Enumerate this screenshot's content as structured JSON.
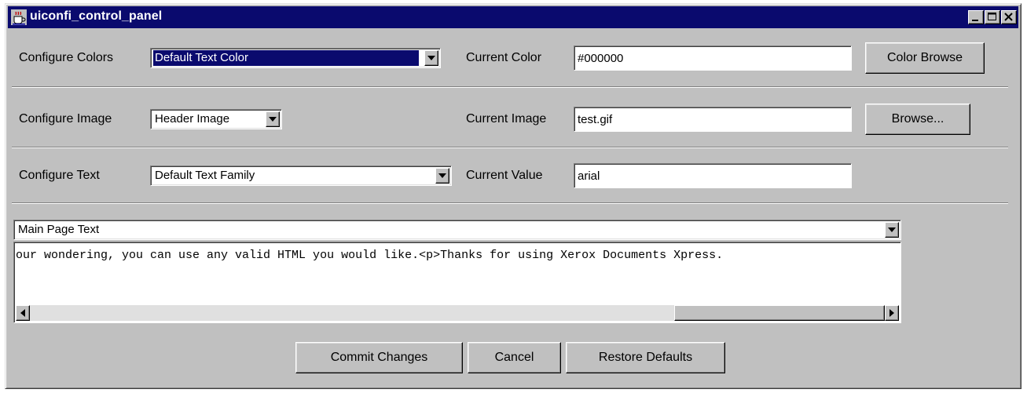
{
  "window": {
    "title": "uiconfi_control_panel",
    "icon": "java-coffee-icon",
    "controls": [
      "minimize-icon",
      "maximize-icon",
      "close-icon"
    ]
  },
  "colors": {
    "label": "Configure Colors",
    "selected": "Default Text Color",
    "current_label": "Current Color",
    "current_value": "#000000",
    "browse_label": "Color Browse"
  },
  "image": {
    "label": "Configure Image",
    "selected": "Header Image",
    "current_label": "Current Image",
    "current_value": "test.gif",
    "browse_label": "Browse..."
  },
  "text": {
    "label": "Configure Text",
    "selected": "Default Text Family",
    "current_label": "Current Value",
    "current_value": "arial"
  },
  "page_text": {
    "selected": "Main Page Text",
    "content": "our wondering, you can use any valid HTML you would like.<p>Thanks for using Xerox Documents Xpress."
  },
  "actions": {
    "commit": "Commit Changes",
    "cancel": "Cancel",
    "restore": "Restore Defaults"
  },
  "palette": {
    "titlebar": "#0a0a6e",
    "face": "#c0c0c0"
  }
}
